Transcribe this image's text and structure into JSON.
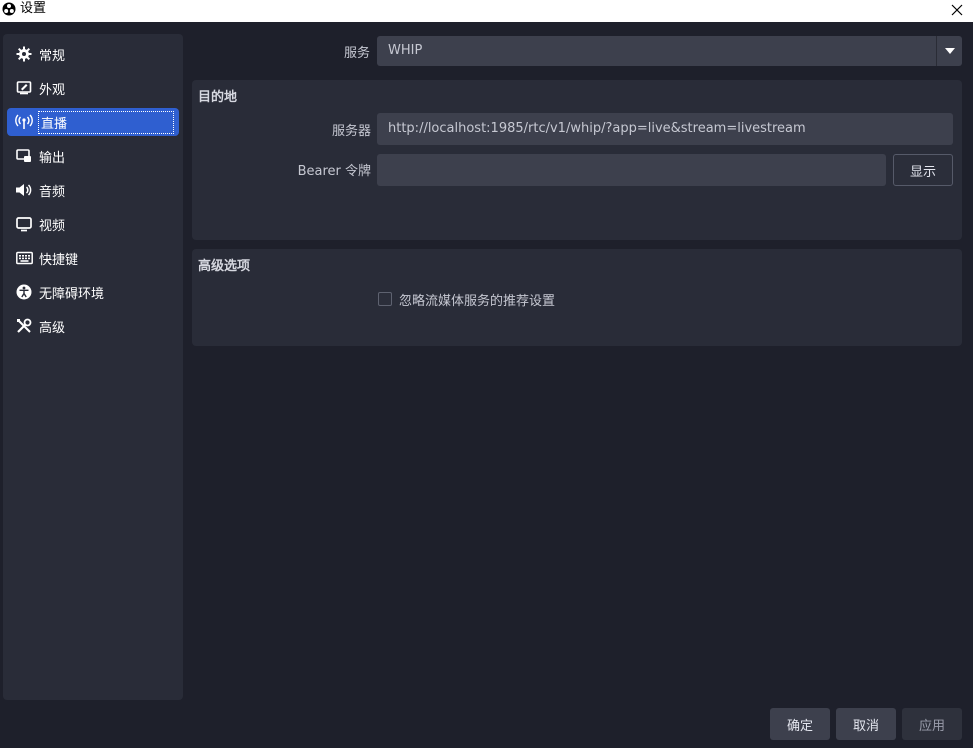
{
  "window": {
    "title": "设置",
    "app_icon": "obs-logo-icon",
    "close_icon": "close-icon"
  },
  "sidebar": {
    "items": [
      {
        "label": "常规",
        "icon": "gear-icon",
        "active": false
      },
      {
        "label": "外观",
        "icon": "appearance-icon",
        "active": false
      },
      {
        "label": "直播",
        "icon": "broadcast-antenna-icon",
        "active": true
      },
      {
        "label": "输出",
        "icon": "output-icon",
        "active": false
      },
      {
        "label": "音频",
        "icon": "speaker-icon",
        "active": false
      },
      {
        "label": "视频",
        "icon": "monitor-icon",
        "active": false
      },
      {
        "label": "快捷键",
        "icon": "keyboard-icon",
        "active": false
      },
      {
        "label": "无障碍环境",
        "icon": "accessibility-icon",
        "active": false
      },
      {
        "label": "高级",
        "icon": "tools-icon",
        "active": false
      }
    ]
  },
  "service": {
    "label": "服务",
    "value": "WHIP"
  },
  "destination": {
    "title": "目的地",
    "server_label": "服务器",
    "server_value": "http://localhost:1985/rtc/v1/whip/?app=live&stream=livestream",
    "bearer_label": "Bearer 令牌",
    "bearer_value": "",
    "show_button": "显示"
  },
  "advanced": {
    "title": "高级选项",
    "ignore_checkbox_label": "忽略流媒体服务的推荐设置",
    "ignore_checked": false
  },
  "footer": {
    "ok": "确定",
    "cancel": "取消",
    "apply": "应用"
  },
  "colors": {
    "background": "#1e202b",
    "panel": "#292c38",
    "input": "#3d404d",
    "accent": "#2f5fd0"
  }
}
